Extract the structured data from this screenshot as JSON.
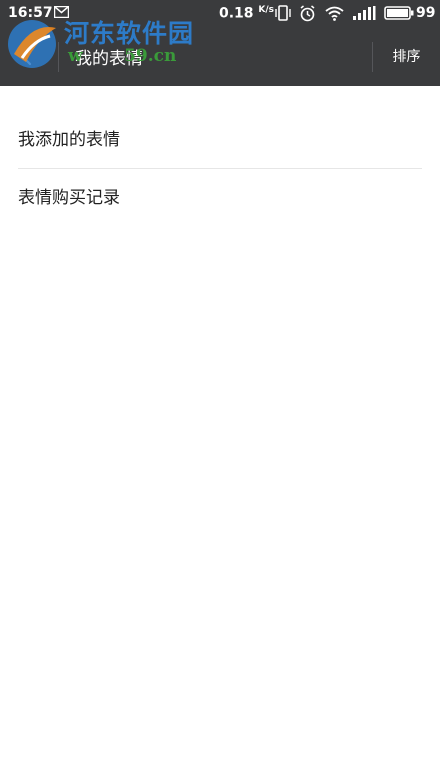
{
  "status_bar": {
    "time": "16:57",
    "net_speed": "0.18",
    "net_speed_unit": "K/s",
    "battery": "99",
    "icons": [
      "message-icon",
      "vibrate-icon",
      "alarm-icon",
      "wifi-icon",
      "signal-icon",
      "battery-icon"
    ]
  },
  "watermark": {
    "name": "河东软件园",
    "url": "w       59.cn"
  },
  "app_bar": {
    "title": "我的表情",
    "sort_label": "排序",
    "back_icon": "back-arrow-icon"
  },
  "menu": {
    "items": [
      {
        "label": "我添加的表情"
      },
      {
        "label": "表情购买记录"
      }
    ]
  },
  "colors": {
    "app_bar_bg": "#3a3b3d",
    "page_bg": "#ffffff",
    "watermark_blue": "#2d7bc8",
    "watermark_green": "#3a9a3a"
  }
}
